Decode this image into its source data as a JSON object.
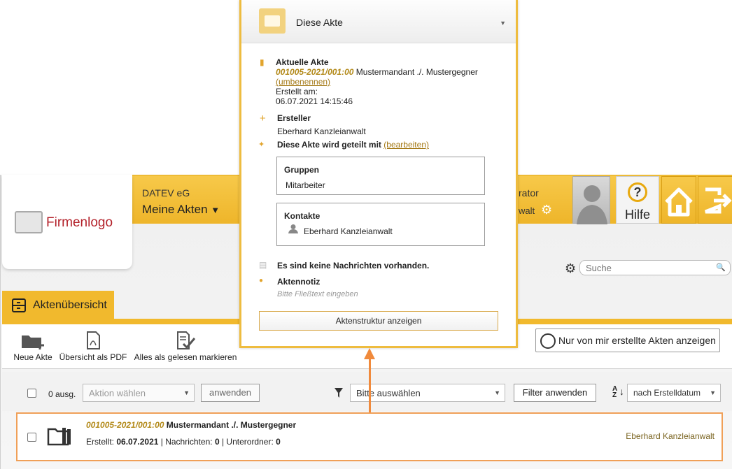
{
  "header": {
    "logo_text": "Firmenlogo",
    "company": "DATEV eG",
    "nav_title": "Meine Akten",
    "user_role": "rator",
    "user_sub": "walt",
    "help_label": "Hilfe"
  },
  "tab": {
    "label": "Aktenübersicht"
  },
  "search": {
    "placeholder": "Suche"
  },
  "toolbar": {
    "new_file": "Neue Akte",
    "overview_pdf": "Übersicht als PDF",
    "mark_read": "Alles als gelesen markieren",
    "only_mine": "Nur von mir erstellte Akten anzeigen"
  },
  "actions": {
    "selected_count": "0 ausg.",
    "action_placeholder": "Aktion wählen",
    "apply": "anwenden",
    "filter_placeholder": "Bitte auswählen",
    "apply_filter": "Filter anwenden",
    "sort_value": "nach Erstelldatum"
  },
  "row": {
    "code": "001005-2021/001:00",
    "title": "Mustermandant ./. Mustergegner",
    "created_label": "Erstellt:",
    "created_value": "06.07.2021",
    "messages_label": "Nachrichten:",
    "messages_value": "0",
    "subfolders_label": "Unterordner:",
    "subfolders_value": "0",
    "owner": "Eberhard Kanzleianwalt"
  },
  "overlay": {
    "title": "Diese Akte",
    "current_label": "Aktuelle Akte",
    "code": "001005-2021/001:00",
    "name": "Mustermandant ./. Mustergegner",
    "rename": "(umbenennen)",
    "created_label": "Erstellt am:",
    "created_value": "06.07.2021 14:15:46",
    "creator_label": "Ersteller",
    "creator_value": "Eberhard Kanzleianwalt",
    "shared_label": "Diese Akte wird geteilt mit",
    "shared_edit": "(bearbeiten)",
    "groups_label": "Gruppen",
    "groups_value": "Mitarbeiter",
    "contacts_label": "Kontakte",
    "contacts_value": "Eberhard Kanzleianwalt",
    "no_messages": "Es sind keine Nachrichten vorhanden.",
    "note_label": "Aktennotiz",
    "note_placeholder": "Bitte Fließtext eingeben",
    "structure_button": "Aktenstruktur anzeigen"
  },
  "colors": {
    "accent": "#f1b92d",
    "highlight": "#f08a3c",
    "code": "#b38a1a"
  }
}
